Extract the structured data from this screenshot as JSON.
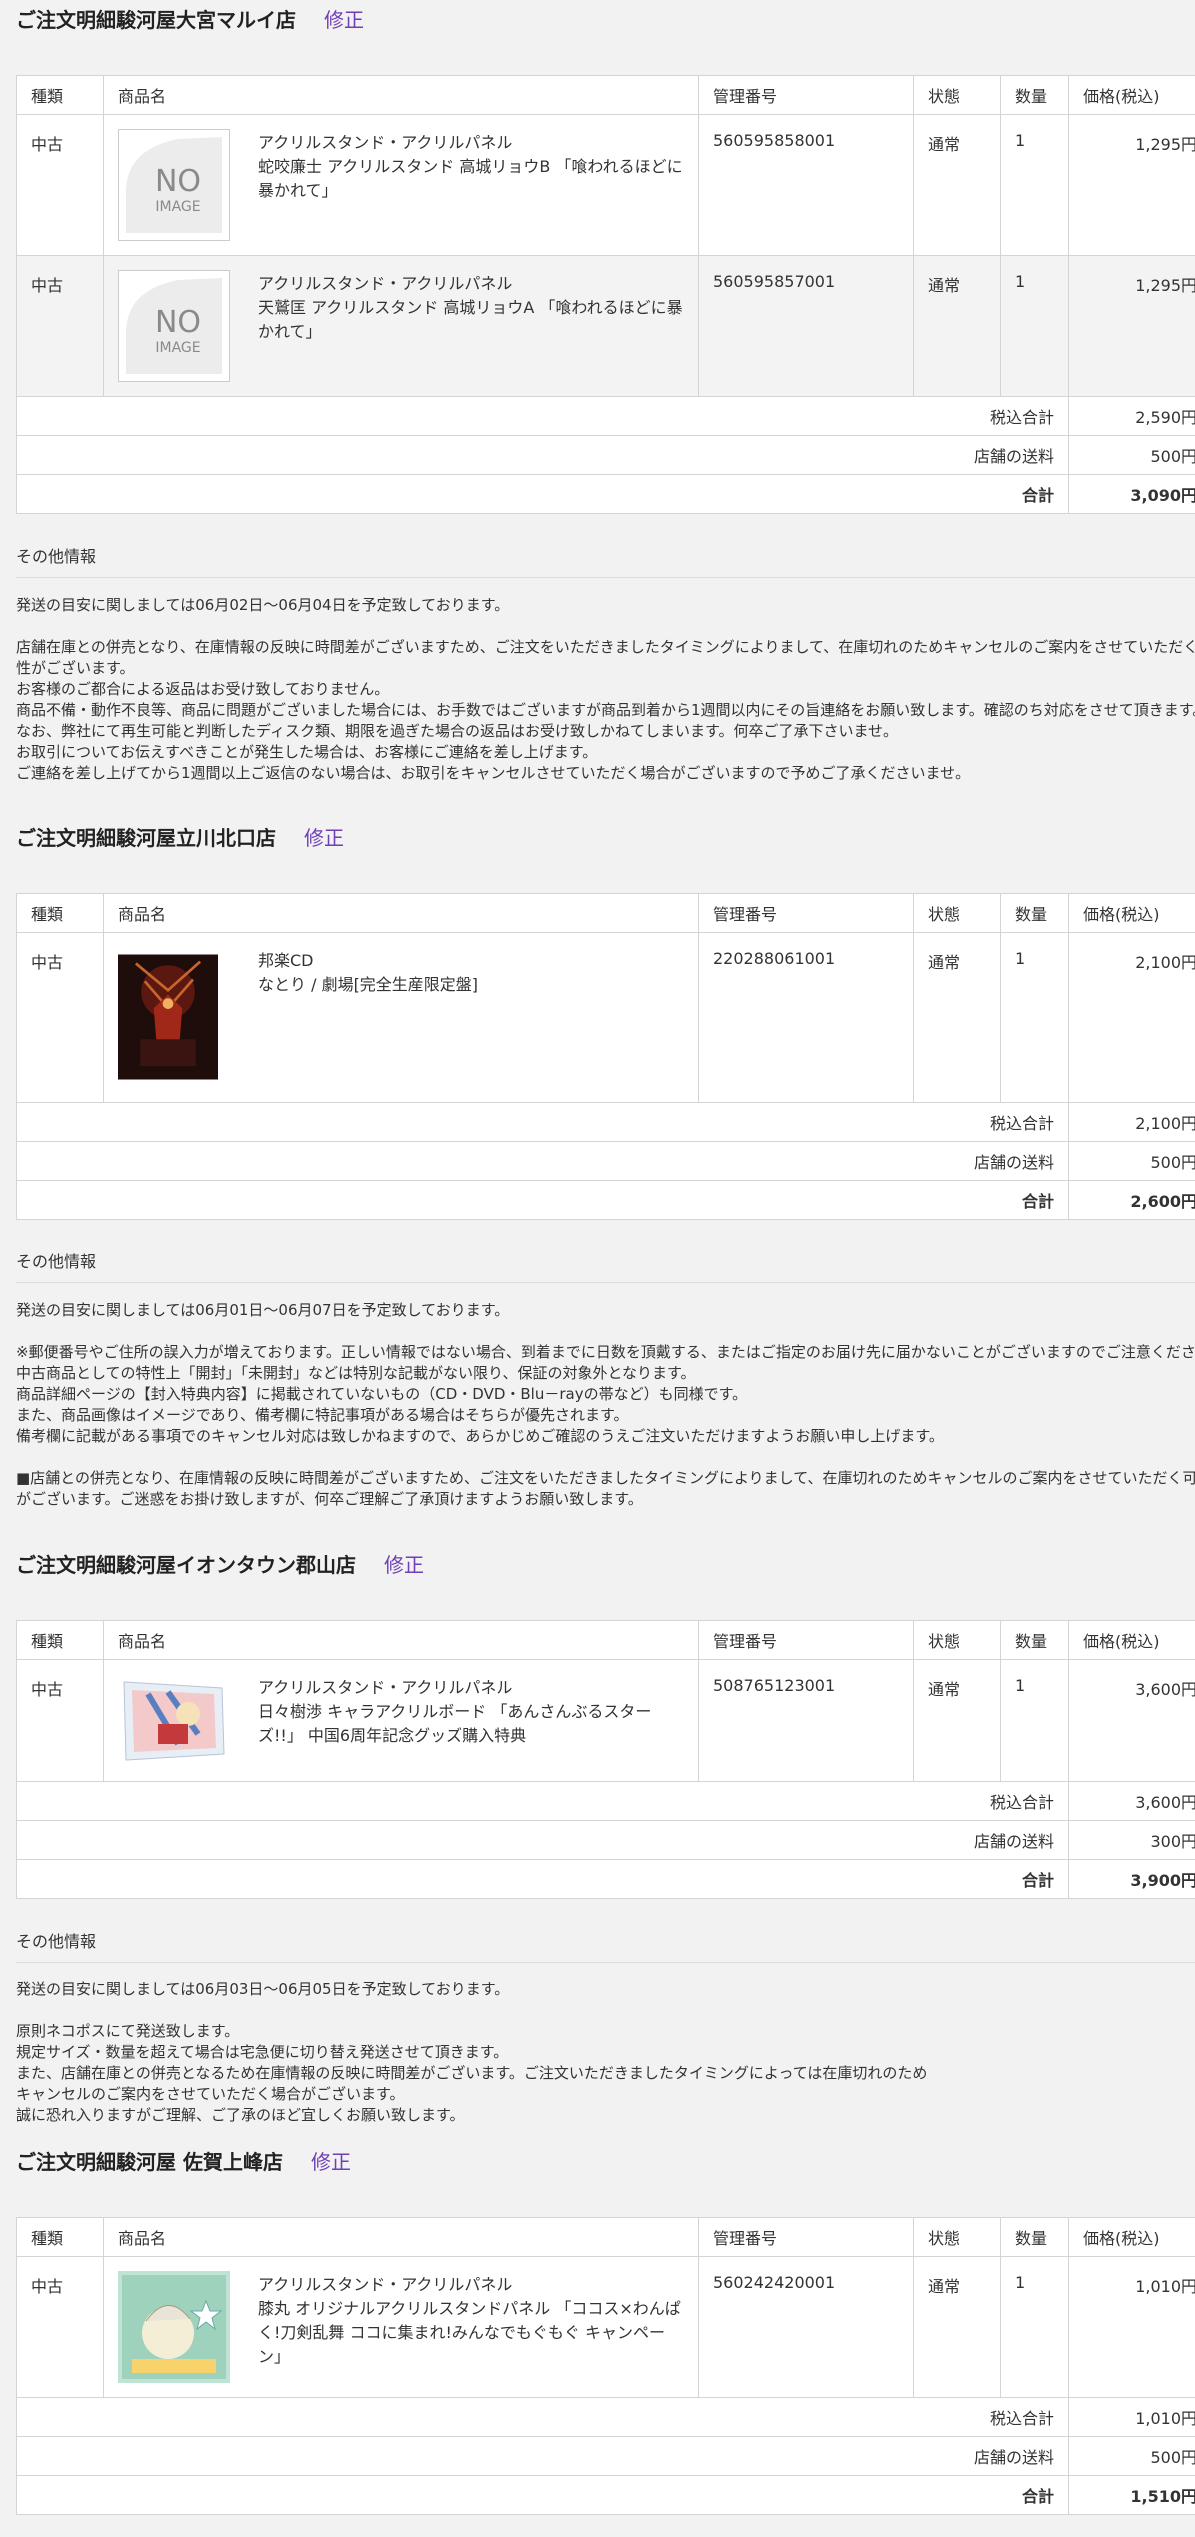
{
  "edit_label": "修正",
  "table_headers": [
    "種類",
    "商品名",
    "管理番号",
    "状態",
    "数量",
    "価格(税込)"
  ],
  "other_info_label": "その他情報",
  "summary_labels": {
    "subtotal": "税込合計",
    "shipping": "店舗の送料",
    "total": "合計"
  },
  "no_image": {
    "line1": "NO",
    "line2": "IMAGE"
  },
  "shops": [
    {
      "title": "ご注文明細駿河屋大宮マルイ店",
      "items": [
        {
          "type": "中古",
          "category": "アクリルスタンド・アクリルパネル",
          "name": "蛇咬廉士 アクリルスタンド 高城リョウB 「喰われるほどに暴かれて」",
          "code": "560595858001",
          "status": "通常",
          "qty": "1",
          "price": "1,295円",
          "image": "no-image"
        },
        {
          "type": "中古",
          "category": "アクリルスタンド・アクリルパネル",
          "name": "天鷲匡 アクリルスタンド 高城リョウA 「喰われるほどに暴かれて」",
          "code": "560595857001",
          "status": "通常",
          "qty": "1",
          "price": "1,295円",
          "image": "no-image"
        }
      ],
      "subtotal": "2,590円",
      "shipping": "500円",
      "total": "3,090円",
      "notes": [
        "発送の目安に関しましては06月02日～06月04日を予定致しております。",
        "",
        "店舗在庫との併売となり、在庫情報の反映に時間差がございますため、ご注文をいただきましたタイミングによりまして、在庫切れのためキャンセルのご案内をさせていただく可能性がございます。",
        "お客様のご都合による返品はお受け致しておりません。",
        "商品不備・動作不良等、商品に問題がございました場合には、お手数ではございますが商品到着から1週間以内にその旨連絡をお願い致します。確認のち対応をさせて頂きます。",
        "なお、弊社にて再生可能と判断したディスク類、期限を過ぎた場合の返品はお受け致しかねてしまいます。何卒ご了承下さいませ。",
        "お取引についてお伝えすべきことが発生した場合は、お客様にご連絡を差し上げます。",
        "ご連絡を差し上げてから1週間以上ご返信のない場合は、お取引をキャンセルさせていただく場合がございますので予めご了承くださいませ。"
      ]
    },
    {
      "title": "ご注文明細駿河屋立川北口店",
      "items": [
        {
          "type": "中古",
          "category": "邦楽CD",
          "name": "なとり / 劇場[完全生産限定盤]",
          "code": "220288061001",
          "status": "通常",
          "qty": "1",
          "price": "2,100円",
          "image": "cd-cover"
        }
      ],
      "subtotal": "2,100円",
      "shipping": "500円",
      "total": "2,600円",
      "notes": [
        "発送の目安に関しましては06月01日～06月07日を予定致しております。",
        "",
        "※郵便番号やご住所の誤入力が増えております。正しい情報ではない場合、到着までに日数を頂戴する、またはご指定のお届け先に届かないことがございますのでご注意ください。",
        "中古商品としての特性上「開封」「未開封」などは特別な記載がない限り、保証の対象外となります。",
        "商品詳細ページの【封入特典内容】に掲載されていないもの（CD・DVD・Blu－rayの帯など）も同様です。",
        "また、商品画像はイメージであり、備考欄に特記事項がある場合はそちらが優先されます。",
        "備考欄に記載がある事項でのキャンセル対応は致しかねますので、あらかじめご確認のうえご注文いただけますようお願い申し上げます。",
        "",
        "■店舗との併売となり、在庫情報の反映に時間差がございますため、ご注文をいただきましたタイミングによりまして、在庫切れのためキャンセルのご案内をさせていただく可能性がございます。ご迷惑をお掛け致しますが、何卒ご理解ご了承頂けますようお願い致します。"
      ]
    },
    {
      "title": "ご注文明細駿河屋イオンタウン郡山店",
      "items": [
        {
          "type": "中古",
          "category": "アクリルスタンド・アクリルパネル",
          "name": "日々樹渉 キャラアクリルボード 「あんさんぶるスターズ!!」 中国6周年記念グッズ購入特典",
          "code": "508765123001",
          "status": "通常",
          "qty": "1",
          "price": "3,600円",
          "image": "acrylic-board"
        }
      ],
      "subtotal": "3,600円",
      "shipping": "300円",
      "total": "3,900円",
      "notes": [
        "発送の目安に関しましては06月03日～06月05日を予定致しております。",
        "",
        "原則ネコポスにて発送致します。",
        "規定サイズ・数量を超えて場合は宅急便に切り替え発送させて頂きます。",
        "また、店舗在庫との併売となるため在庫情報の反映に時間差がございます。ご注文いただきましたタイミングによっては在庫切れのため",
        "キャンセルのご案内をさせていただく場合がございます。",
        "誠に恐れ入りますがご理解、ご了承のほど宜しくお願い致します。"
      ]
    },
    {
      "title": "ご注文明細駿河屋 佐賀上峰店",
      "items": [
        {
          "type": "中古",
          "category": "アクリルスタンド・アクリルパネル",
          "name": "膝丸 オリジナルアクリルスタンドパネル 「ココス×わんぱく!刀剣乱舞 ココに集まれ!みんなでもぐもぐ キャンペーン」",
          "code": "560242420001",
          "status": "通常",
          "qty": "1",
          "price": "1,010円",
          "image": "acrylic-panel"
        }
      ],
      "subtotal": "1,010円",
      "shipping": "500円",
      "total": "1,510円",
      "notes": []
    }
  ]
}
